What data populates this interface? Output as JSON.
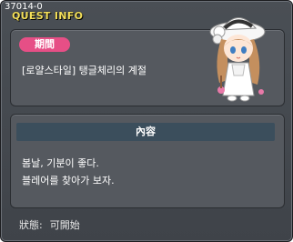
{
  "quest_id": "37014-0",
  "title": "QUEST INFO",
  "period_label": "期間",
  "quest_name": "[로얄스타일] 탱글체리의 계절",
  "content_header": "內容",
  "content_lines": [
    "봄날, 기분이 좋다.",
    "블레어를 찾아가 보자."
  ],
  "status": {
    "label": "狀態:",
    "value": "可開始"
  },
  "npc_icon": "npc-girl-white-hat-icon",
  "colors": {
    "title": "#f4e05a",
    "badge": "#e64f86",
    "panel": "#55595f",
    "content_header": "#3b4e5c"
  }
}
